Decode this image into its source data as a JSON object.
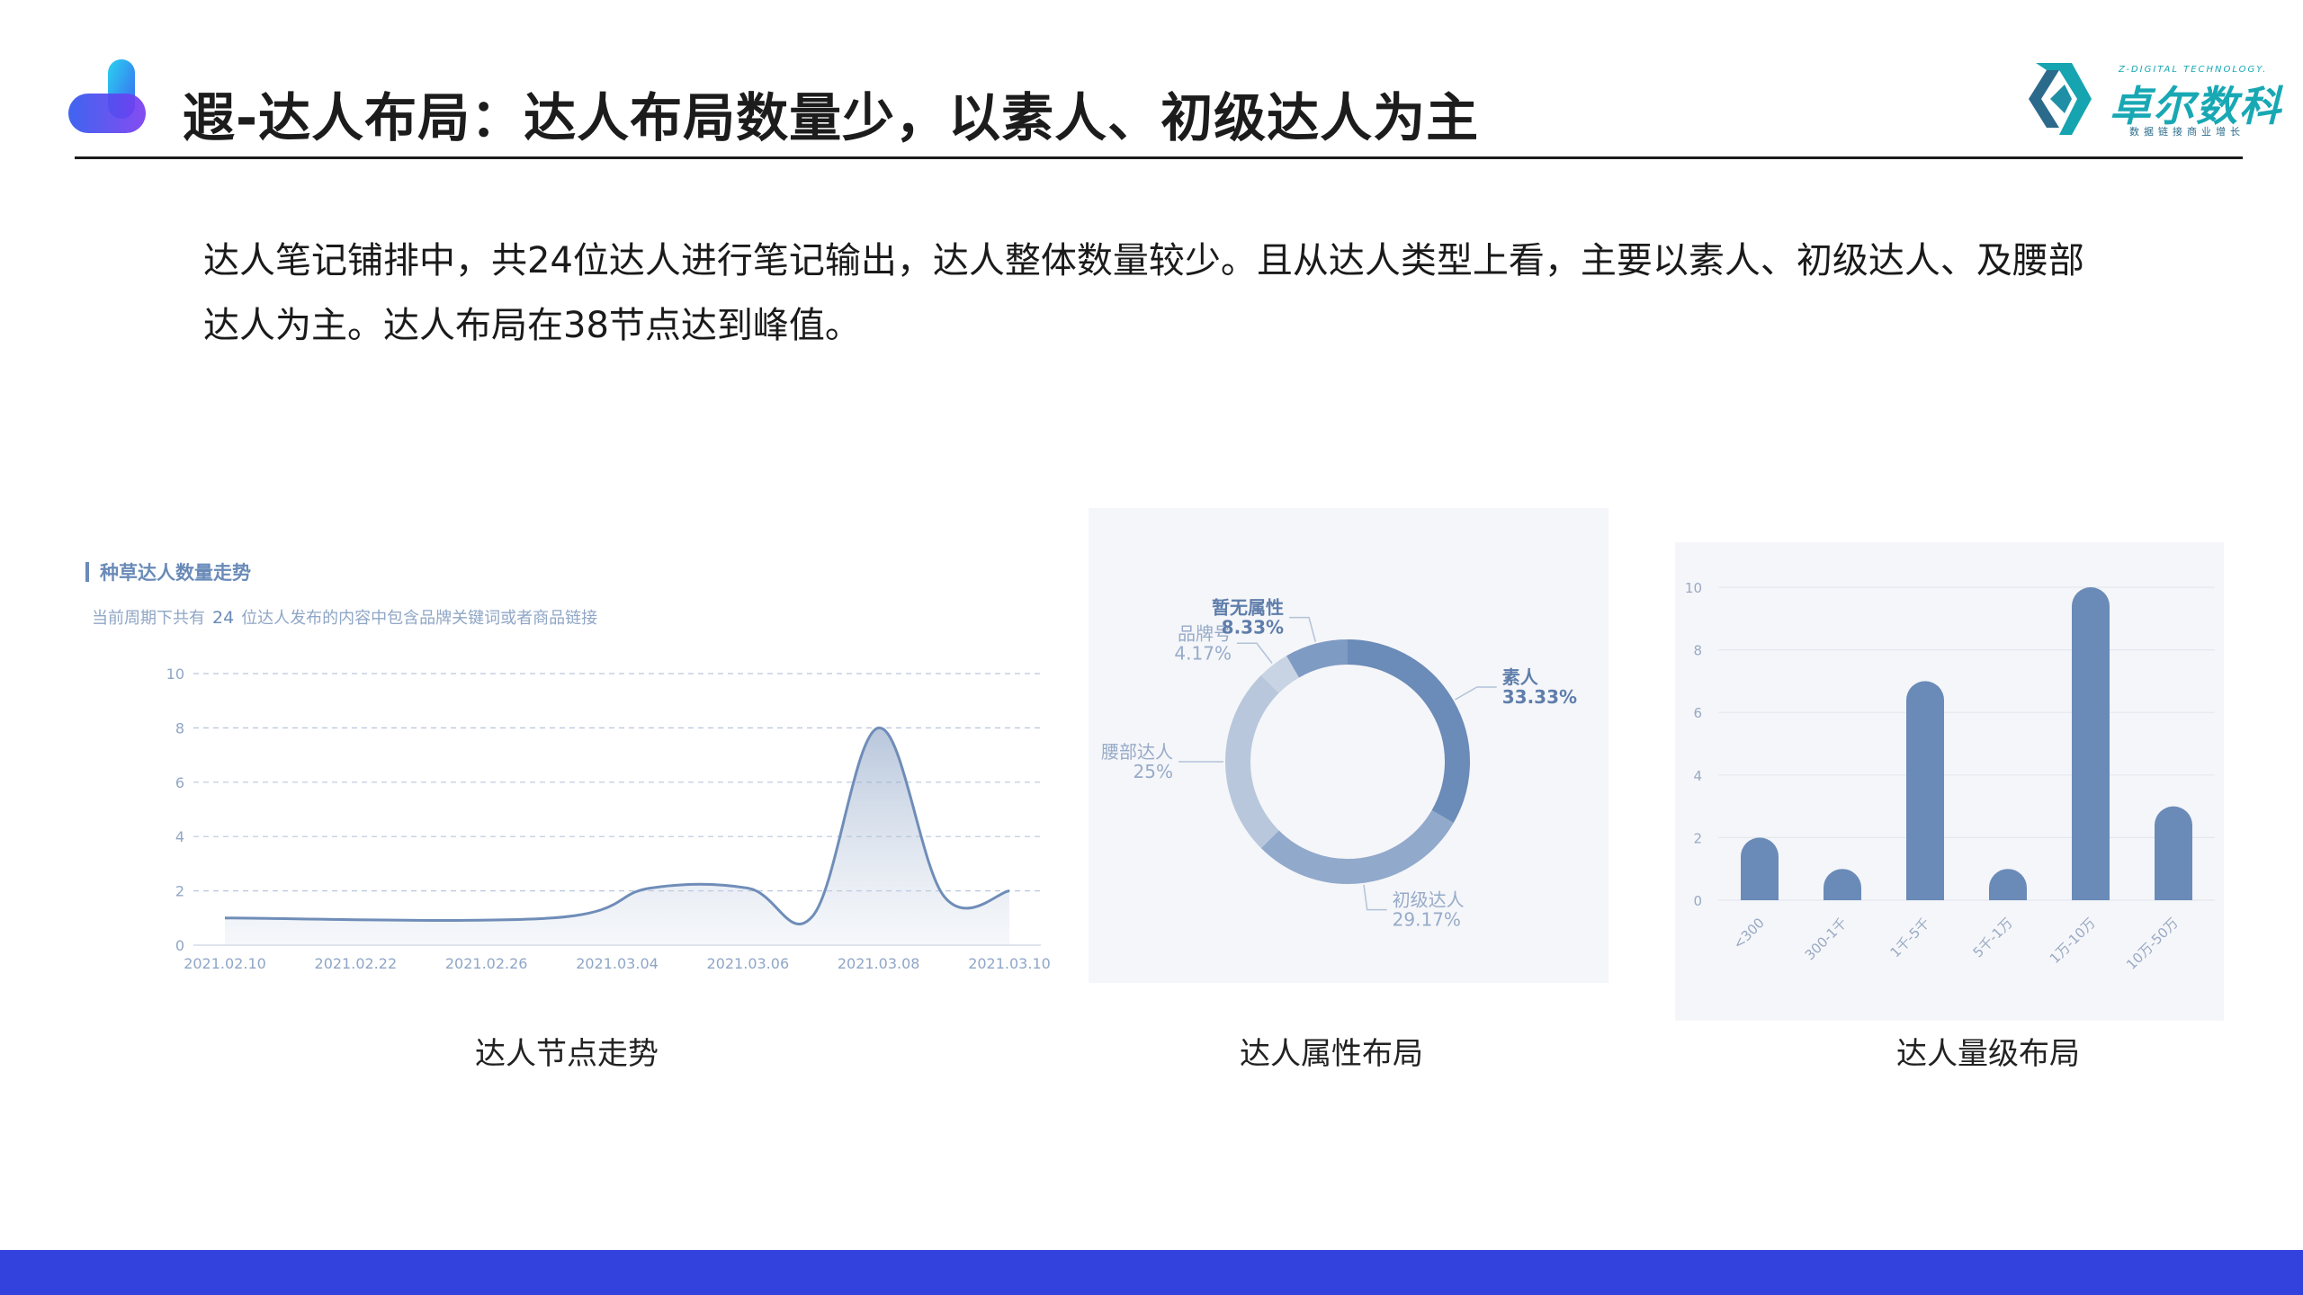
{
  "header": {
    "title": "遐-达人布局：达人布局数量少，以素人、初级达人为主",
    "brand_name": "卓尔数科",
    "brand_en": "Z-DIGITAL TECHNOLOGY.",
    "brand_sub": "数据链接商业增长"
  },
  "summary": "达人笔记铺排中，共24位达人进行笔记输出，达人整体数量较少。且从达人类型上看，主要以素人、初级达人、及腰部达人为主。达人布局在38节点达到峰值。",
  "captions": {
    "trend": "达人节点走势",
    "attribute": "达人属性布局",
    "level": "达人量级布局"
  },
  "colors": {
    "accent": "#3342dd",
    "chart_blue": "#6a8bb8",
    "brand_teal": "#18a8b4"
  },
  "chart_data": [
    {
      "type": "area",
      "title": "种草达人数量走势",
      "subtitle_parts": [
        "当前周期下共有",
        "24",
        "位达人发布的内容中包含品牌关键词或者商品链接"
      ],
      "x": [
        "2021.02.10",
        "2021.02.22",
        "2021.02.26",
        "2021.03.04",
        "2021.03.06",
        "2021.03.08",
        "2021.03.10"
      ],
      "x_positions": [
        0,
        1,
        2,
        3,
        4,
        5,
        6
      ],
      "points": [
        [
          0,
          1
        ],
        [
          2.5,
          1
        ],
        [
          3.25,
          2.1
        ],
        [
          4,
          2.1
        ],
        [
          4.5,
          1.1
        ],
        [
          5,
          8
        ],
        [
          5.5,
          1.8
        ],
        [
          6,
          2
        ]
      ],
      "ylim": [
        0,
        10
      ],
      "yticks": [
        0,
        2,
        4,
        6,
        8,
        10
      ],
      "grid": true
    },
    {
      "type": "pie",
      "donut": true,
      "slices": [
        {
          "name": "素人",
          "label": "33.33%",
          "value": 33.33
        },
        {
          "name": "初级达人",
          "label": "29.17%",
          "value": 29.17
        },
        {
          "name": "腰部达人",
          "label": "25%",
          "value": 25
        },
        {
          "name": "品牌号",
          "label": "4.17%",
          "value": 4.17
        },
        {
          "name": "暂无属性",
          "label": "8.33%",
          "value": 8.33
        }
      ],
      "colors": [
        "#6b8bb8",
        "#91a9cb",
        "#b8c7dc",
        "#c8d4e4",
        "#7e9bc3"
      ]
    },
    {
      "type": "bar",
      "categories": [
        "<300",
        "300-1千",
        "1千-5千",
        "5千-1万",
        "1万-10万",
        "10万-50万"
      ],
      "values": [
        2,
        1,
        7,
        1,
        10,
        3
      ],
      "ylim": [
        0,
        10
      ],
      "yticks": [
        0,
        2,
        4,
        6,
        8,
        10
      ],
      "grid": true
    }
  ]
}
